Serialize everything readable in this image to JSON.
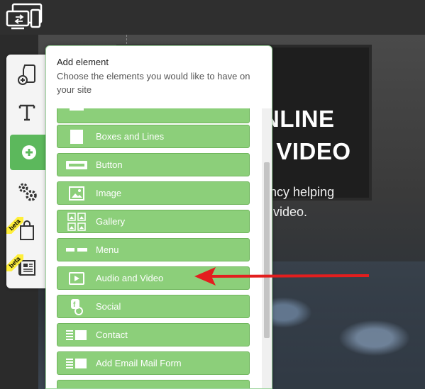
{
  "toolbar": {
    "device_icon": "devices-icon"
  },
  "hero": {
    "title_line1": "NLINE",
    "title_line2": "I VIDEO",
    "sub_line1": "ency helping",
    "sub_line2": "h video."
  },
  "sidebar": {
    "items": [
      {
        "name": "pages",
        "icon": "page-add-icon"
      },
      {
        "name": "text",
        "icon": "text-icon"
      },
      {
        "name": "add-element",
        "icon": "plus-icon",
        "active": true
      },
      {
        "name": "settings",
        "icon": "gears-icon"
      },
      {
        "name": "store",
        "icon": "shopping-bag-icon",
        "badge": "beta"
      },
      {
        "name": "blog",
        "icon": "newspaper-icon",
        "badge": "beta"
      }
    ]
  },
  "panel": {
    "title": "Add element",
    "description": "Choose the elements you would like to have on your site",
    "items": [
      {
        "label": "Boxes and Lines",
        "icon": "box-icon"
      },
      {
        "label": "Button",
        "icon": "button-icon"
      },
      {
        "label": "Image",
        "icon": "image-icon"
      },
      {
        "label": "Gallery",
        "icon": "gallery-icon"
      },
      {
        "label": "Menu",
        "icon": "menu-icon"
      },
      {
        "label": "Audio and Video",
        "icon": "audio-video-icon"
      },
      {
        "label": "Social",
        "icon": "social-icon"
      },
      {
        "label": "Contact",
        "icon": "contact-icon"
      },
      {
        "label": "Add Email Mail Form",
        "icon": "mail-form-icon"
      }
    ]
  },
  "annotation": {
    "color": "#e31e1e"
  },
  "colors": {
    "accent": "#5cb85c",
    "item_bg": "#8ccf7a"
  }
}
